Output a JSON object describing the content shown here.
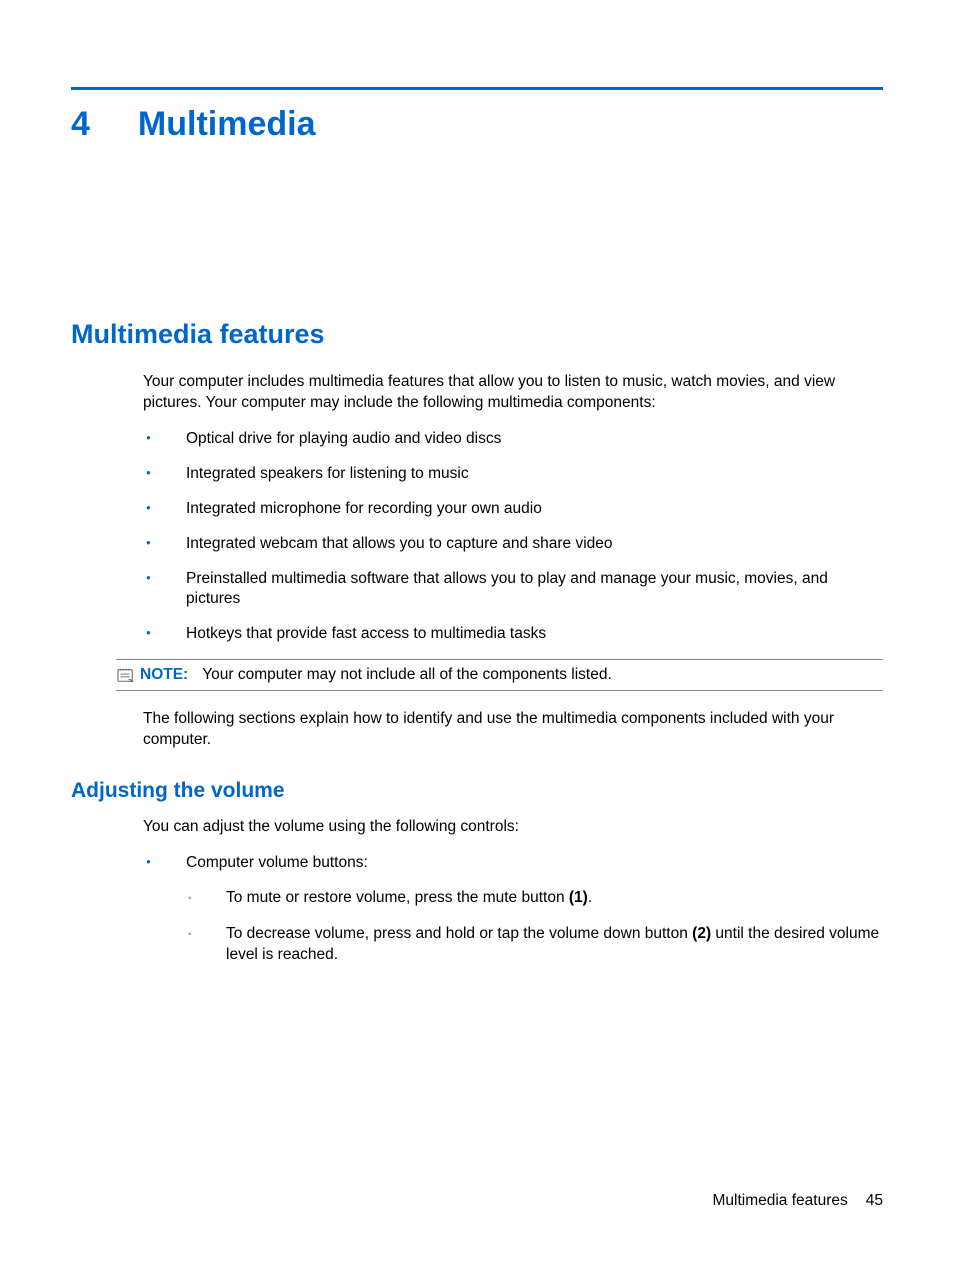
{
  "chapter": {
    "number": "4",
    "title": "Multimedia"
  },
  "section1": {
    "heading": "Multimedia features",
    "intro": "Your computer includes multimedia features that allow you to listen to music, watch movies, and view pictures. Your computer may include the following multimedia components:",
    "bullets": [
      "Optical drive for playing audio and video discs",
      "Integrated speakers for listening to music",
      "Integrated microphone for recording your own audio",
      "Integrated webcam that allows you to capture and share video",
      "Preinstalled multimedia software that allows you to play and manage your music, movies, and pictures",
      "Hotkeys that provide fast access to multimedia tasks"
    ],
    "note_label": "NOTE:",
    "note_text": "Your computer may not include all of the components listed.",
    "outro": "The following sections explain how to identify and use the multimedia components included with your computer."
  },
  "section2": {
    "heading": "Adjusting the volume",
    "intro": "You can adjust the volume using the following controls:",
    "bullet1": "Computer volume buttons:",
    "sub1_a": "To mute or restore volume, press the mute button ",
    "sub1_ref": "(1)",
    "sub1_b": ".",
    "sub2_a": "To decrease volume, press and hold or tap the volume down button ",
    "sub2_ref": "(2)",
    "sub2_b": " until the desired volume level is reached."
  },
  "footer": {
    "section": "Multimedia features",
    "page": "45"
  }
}
